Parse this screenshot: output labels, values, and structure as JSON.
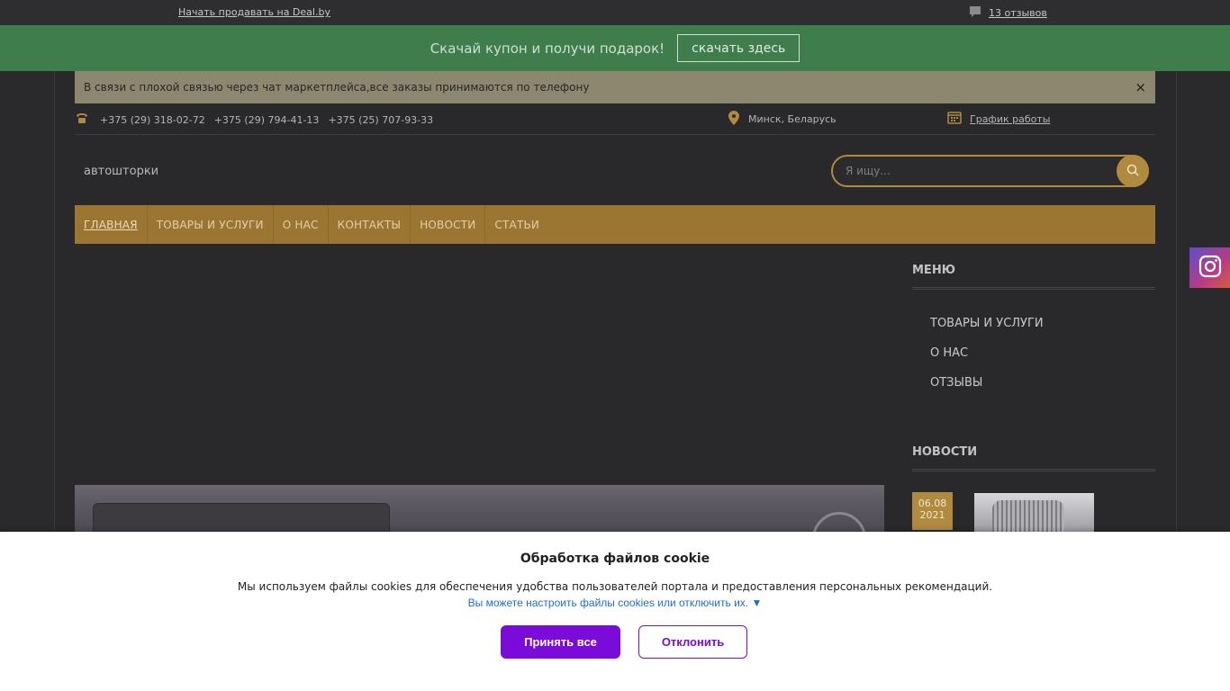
{
  "topbar": {
    "sell_link": "Начать продавать на Deal.by",
    "reviews_link": "13 отзывов"
  },
  "coupon": {
    "text": "Скачай купон и получи подарок!",
    "button": "скачать здесь"
  },
  "notice": {
    "text": "В связи с плохой связью через чат маркетплейса,все заказы принимаются по телефону",
    "close": "×"
  },
  "contacts": {
    "phones": [
      "+375 (29) 318-02-72",
      "+375 (29) 794-41-13",
      "+375 (25) 707-93-33"
    ],
    "location": "Минск, Беларусь",
    "schedule": "График работы"
  },
  "brand": {
    "tagline": "автошторки"
  },
  "search": {
    "placeholder": "Я ищу..."
  },
  "nav": {
    "items": [
      "ГЛАВНАЯ",
      "ТОВАРЫ И УСЛУГИ",
      "О НАС",
      "КОНТАКТЫ",
      "НОВОСТИ",
      "СТАТЬИ"
    ]
  },
  "sidebar": {
    "menu_title": "МЕНЮ",
    "menu_items": [
      "ТОВАРЫ И УСЛУГИ",
      "О НАС",
      "ОТЗЫВЫ"
    ],
    "news_title": "НОВОСТИ",
    "news": [
      {
        "date_day": "06.08",
        "date_year": "2021"
      }
    ]
  },
  "cookie": {
    "title": "Обработка файлов cookie",
    "description": "Мы используем файлы cookies для обеспечения удобства пользователей портала и предоставления персональных рекомендаций.",
    "settings_link": "Вы можете настроить файлы cookies или отключить их. ▼",
    "accept": "Принять все",
    "decline": "Отклонить"
  },
  "colors": {
    "accent": "#b08a3e",
    "coupon_bar": "#3f7d4d",
    "nav_bar": "#9b7633",
    "cookie_button": "#7a0bd8"
  }
}
